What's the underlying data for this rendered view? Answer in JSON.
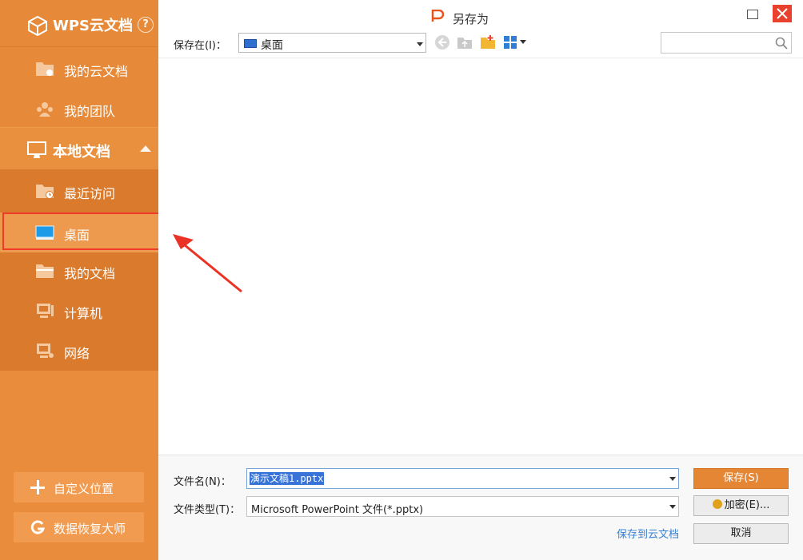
{
  "sidebar": {
    "brand": {
      "title": "WPS云文档",
      "help": "?"
    },
    "cloud_items": [
      {
        "label": "我的云文档",
        "icon": "cloud-folder-icon"
      },
      {
        "label": "我的团队",
        "icon": "team-icon"
      }
    ],
    "local_header": {
      "label": "本地文档",
      "icon": "monitor-icon"
    },
    "local_items": [
      {
        "label": "最近访问",
        "icon": "recent-folder-icon"
      },
      {
        "label": "桌面",
        "icon": "desktop-icon",
        "active": true
      },
      {
        "label": "我的文档",
        "icon": "documents-folder-icon"
      },
      {
        "label": "计算机",
        "icon": "computer-icon"
      },
      {
        "label": "网络",
        "icon": "network-icon"
      }
    ],
    "buttons": [
      {
        "label": "自定义位置",
        "icon": "plus-icon"
      },
      {
        "label": "数据恢复大师",
        "icon": "recovery-icon"
      }
    ]
  },
  "dialog": {
    "title": "另存为",
    "save_in_label": "保存在(I)：",
    "save_in_value": "桌面",
    "search_placeholder": "",
    "file_name_label": "文件名(N)：",
    "file_name_value": "演示文稿1.pptx",
    "file_type_label": "文件类型(T)：",
    "file_type_value": "Microsoft PowerPoint 文件(*.pptx)",
    "save_to_cloud": "保存到云文档",
    "buttons": {
      "save": "保存(S)",
      "encrypt": "加密(E)...",
      "cancel": "取消"
    }
  },
  "colors": {
    "sidebar": "#e98d3c",
    "accent": "#e58635",
    "highlight": "#f23a2a",
    "link": "#3a7fd0"
  }
}
